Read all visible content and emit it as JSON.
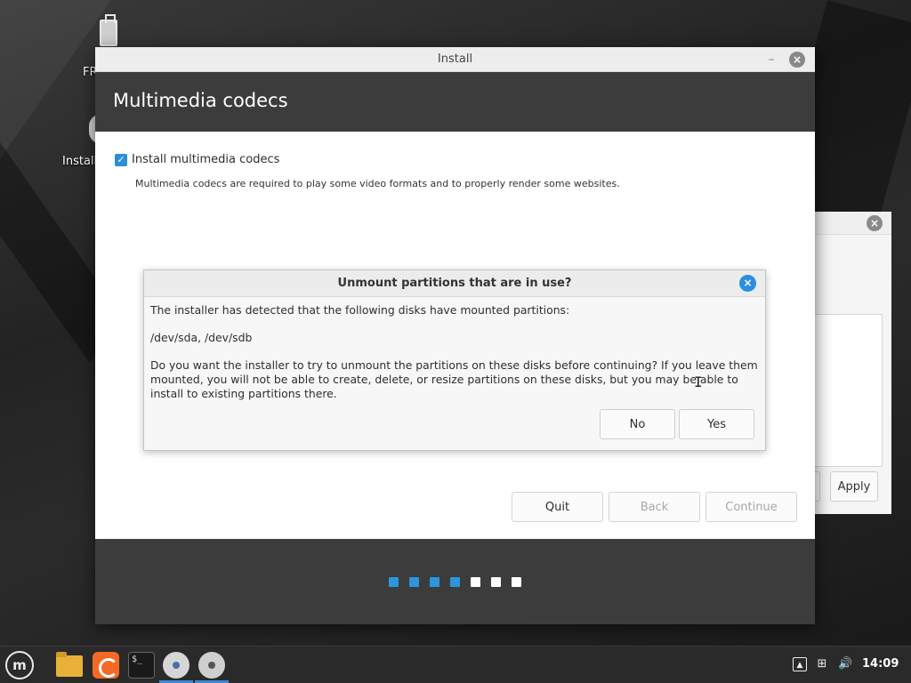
{
  "desktop": {
    "icon1_label": "FR",
    "icon2_label": "Install"
  },
  "back_window": {
    "close_glyph": "×",
    "apply_label": "Apply"
  },
  "installer": {
    "window_title": "Install",
    "minimize_glyph": "–",
    "close_glyph": "×",
    "heading": "Multimedia codecs",
    "checkbox_label": "Install multimedia codecs",
    "checkbox_checked": true,
    "description": "Multimedia codecs are required to play some video formats and to properly render some websites.",
    "buttons": {
      "quit": "Quit",
      "back": "Back",
      "continue": "Continue"
    },
    "progress": {
      "total_steps": 7,
      "completed_steps": 4,
      "completed_color": "#2b96de",
      "pending_color": "#ffffff"
    }
  },
  "dialog": {
    "title": "Unmount partitions that are in use?",
    "close_glyph": "×",
    "line1": "The installer has detected that the following disks have mounted partitions:",
    "disks": "/dev/sda, /dev/sdb",
    "question": "Do you want the installer to try to unmount the partitions on these disks before continuing?  If you leave them mounted, you will not be able to create, delete, or resize partitions on these disks, but you may be able to install to existing partitions there.",
    "no_label": "No",
    "yes_label": "Yes",
    "accent_color": "#2b8ee0"
  },
  "taskbar": {
    "terminal_glyph": "$_",
    "clock": "14:09",
    "icons": [
      "menu-icon",
      "folder-icon",
      "firefox-icon",
      "terminal-icon",
      "installer-icon",
      "disc-icon"
    ],
    "tray_icons": [
      "update-manager-icon",
      "network-icon",
      "volume-icon"
    ]
  }
}
